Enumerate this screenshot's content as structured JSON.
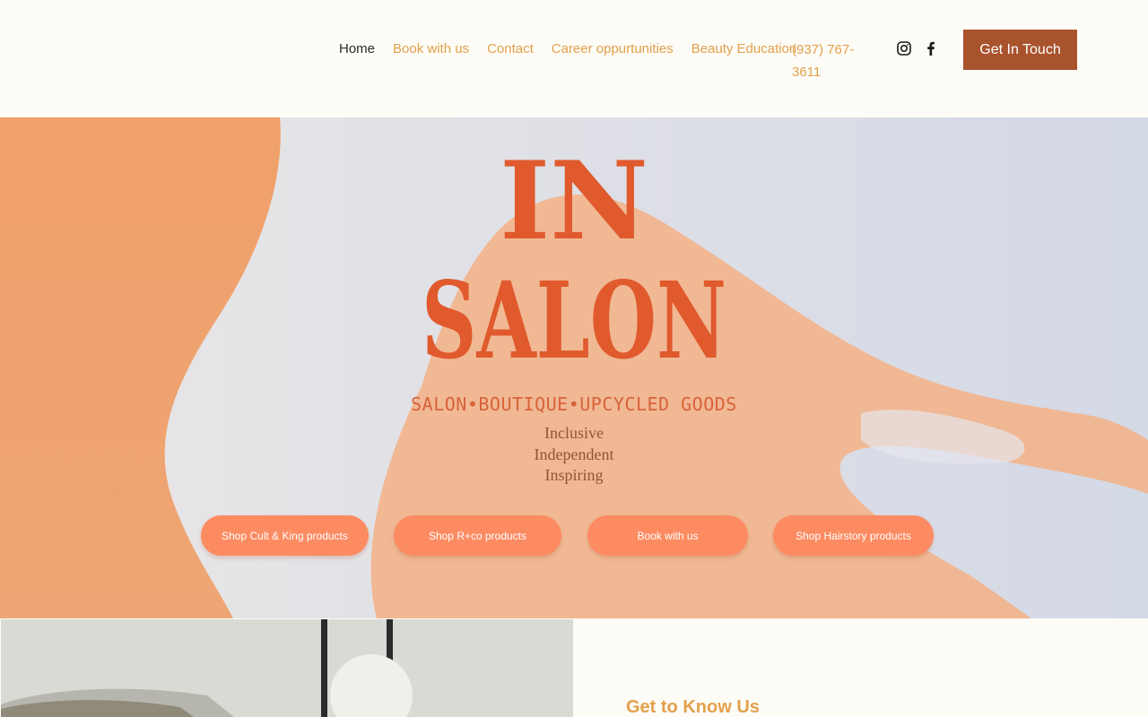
{
  "nav": {
    "items": [
      {
        "label": "Home",
        "active": true
      },
      {
        "label": "Book with us",
        "active": false
      },
      {
        "label": "Contact",
        "active": false
      },
      {
        "label": "Career oppurtunities",
        "active": false
      },
      {
        "label": "Beauty Education",
        "active": false
      }
    ],
    "phone": "(937) 767-3611",
    "social_icons": [
      "instagram-icon",
      "facebook-icon"
    ],
    "cta_label": "Get In Touch"
  },
  "hero": {
    "logo_line1": "IN",
    "logo_line2": "SALON",
    "tagline": "SALON•BOUTIQUE•UPCYCLED GOODS",
    "values": [
      "Inclusive",
      "Independent",
      "Inspiring"
    ],
    "buttons": [
      "Shop Cult & King products",
      "Shop R+co products",
      "Book with us",
      "Shop Hairstory products"
    ]
  },
  "about": {
    "heading": "Get to Know Us"
  },
  "colors": {
    "background": "#fdfcf7",
    "accent": "#e3a04b",
    "cta": "#a9532d",
    "pill": "#fd8b62",
    "logo": "#e05a2d"
  }
}
